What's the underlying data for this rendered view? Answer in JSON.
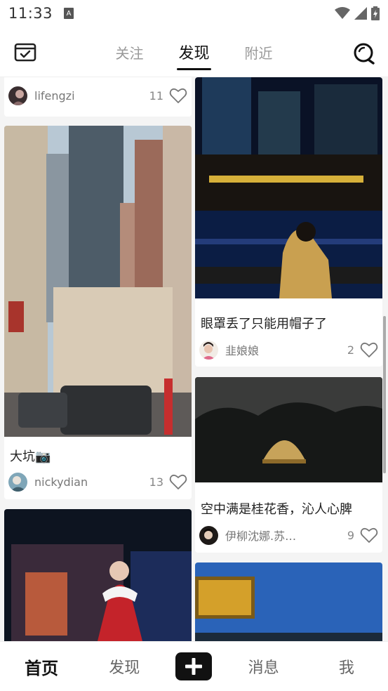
{
  "status_bar": {
    "time": "11:33",
    "notification_letter": "A"
  },
  "header": {
    "tabs": [
      {
        "label": "关注",
        "active": false
      },
      {
        "label": "发现",
        "active": true
      },
      {
        "label": "附近",
        "active": false
      }
    ],
    "left_icon": "calendar-checkin-icon",
    "right_icon": "search-icon"
  },
  "feed": {
    "left_column": [
      {
        "title": "",
        "author": "lifengzi",
        "likes": "11"
      },
      {
        "title": "大坑📷",
        "author": "nickydian",
        "likes": "13"
      },
      {
        "title": "",
        "author": "",
        "likes": ""
      }
    ],
    "right_column": [
      {
        "title": "眼罩丢了只能用帽子了",
        "author": "韭娘娘",
        "likes": "2"
      },
      {
        "title": "空中满是桂花香，沁人心脾",
        "author": "伊柳沈娜.苏…",
        "likes": "9"
      },
      {
        "title": "",
        "author": "",
        "likes": ""
      }
    ]
  },
  "tabbar": {
    "items": [
      {
        "label": "首页",
        "active": true
      },
      {
        "label": "发现",
        "active": false
      },
      {
        "label": "消息",
        "active": false
      },
      {
        "label": "我",
        "active": false
      }
    ]
  },
  "colors": {
    "accent": "#111111",
    "muted": "#999999"
  }
}
